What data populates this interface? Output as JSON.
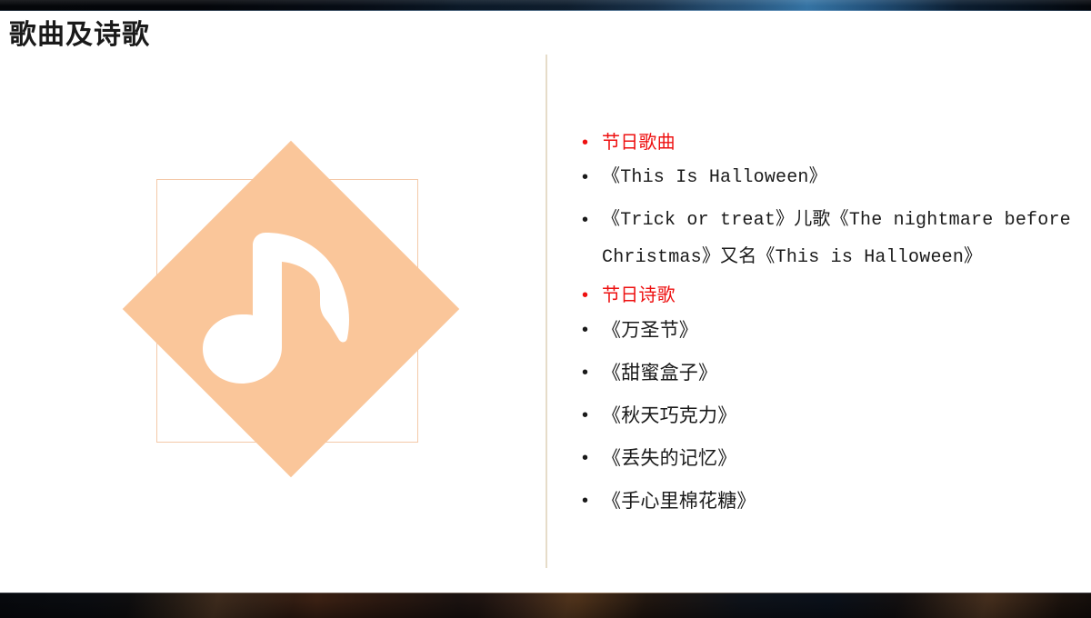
{
  "slide": {
    "title": "歌曲及诗歌",
    "background_color": "#ffffff"
  },
  "decor": {
    "top_banner_name": "top-decorative-banner",
    "bottom_banner_name": "bottom-decorative-banner",
    "divider_color": "#e6dcc9",
    "accent_color": "#fac69a",
    "frame_border_color": "#f4c9a8",
    "highlight_color": "#ee1111",
    "text_color": "#1a1a1a"
  },
  "illustration": {
    "icon": "music-note-icon",
    "shape": "diamond",
    "frame": "square-outline",
    "fill_color": "#fac69a",
    "note_color": "#ffffff"
  },
  "bullets": [
    {
      "marker": "•",
      "text": "节日歌曲",
      "style": "accent"
    },
    {
      "marker": "•",
      "text": "《This Is Halloween》",
      "style": "mono"
    },
    {
      "marker": "•",
      "text": "《Trick or treat》儿歌《The nightmare before Christmas》又名《This is Halloween》",
      "style": "mono"
    },
    {
      "marker": "•",
      "text": "节日诗歌",
      "style": "accent"
    },
    {
      "marker": "•",
      "text": "《万圣节》",
      "style": "cjk"
    },
    {
      "marker": "•",
      "text": "《甜蜜盒子》",
      "style": "cjk"
    },
    {
      "marker": "•",
      "text": "《秋天巧克力》",
      "style": "cjk"
    },
    {
      "marker": "•",
      "text": "《丢失的记忆》",
      "style": "cjk"
    },
    {
      "marker": "•",
      "text": "《手心里棉花糖》",
      "style": "cjk"
    }
  ]
}
